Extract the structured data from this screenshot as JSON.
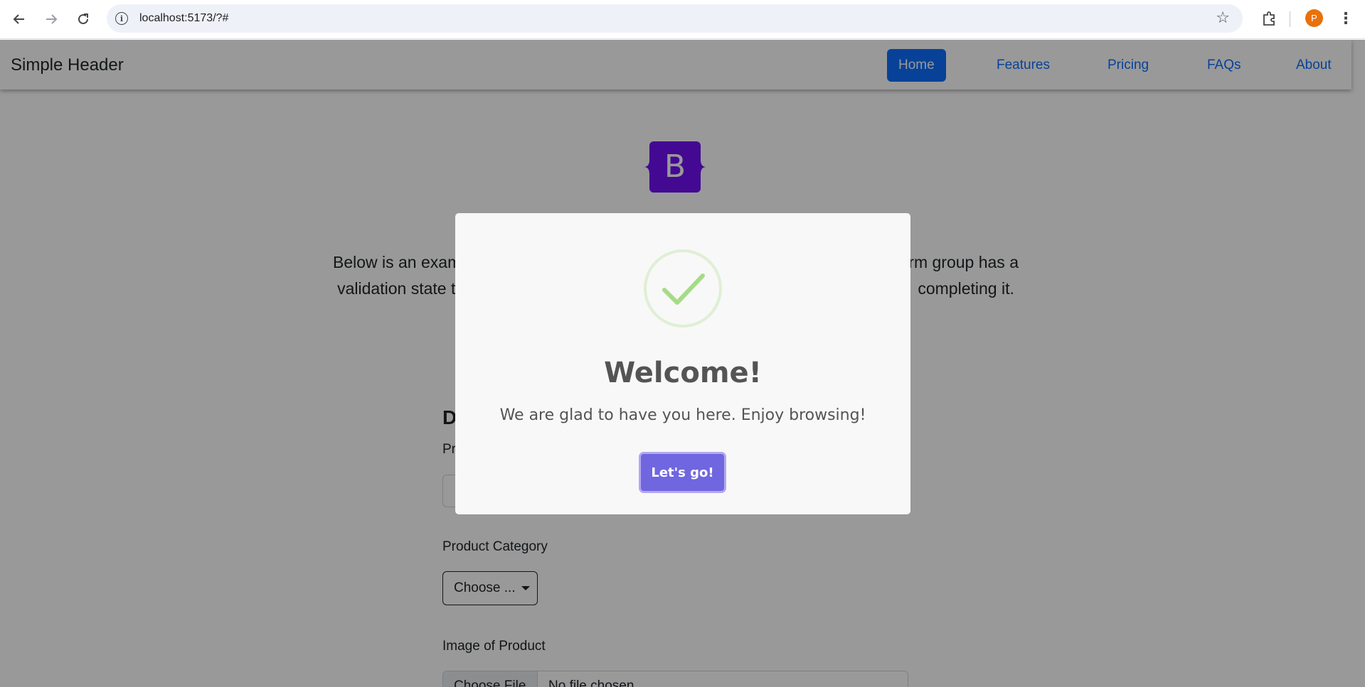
{
  "browser": {
    "url": "localhost:5173/?#",
    "profile_initial": "P",
    "back_icon": "arrow-left-icon",
    "forward_icon": "arrow-right-icon",
    "reload_icon": "reload-icon"
  },
  "header": {
    "brand": "Simple Header",
    "nav": [
      {
        "label": "Home",
        "active": true
      },
      {
        "label": "Features",
        "active": false
      },
      {
        "label": "Pricing",
        "active": false
      },
      {
        "label": "FAQs",
        "active": false
      },
      {
        "label": "About",
        "active": false
      }
    ],
    "accent_color": "#0d6efd"
  },
  "main": {
    "logo_letter": "B",
    "lead_line1_left": "Below is an example",
    "lead_line1_right": "d form group has a",
    "lead_line2_left": "validation state t",
    "lead_line2_right": "completing it.",
    "form_title_visible": "D",
    "label_name_visible": "Pr",
    "label_category": "Product Category",
    "category_select": "Choose ...",
    "label_image": "Image of Product",
    "file_button": "Choose File",
    "file_status": "No file chosen"
  },
  "modal": {
    "icon": "success-check-icon",
    "title": "Welcome!",
    "text": "We are glad to have you here. Enjoy browsing!",
    "confirm_label": "Let's go!",
    "confirm_color": "#7066e0",
    "success_color": "#a5dc86"
  }
}
